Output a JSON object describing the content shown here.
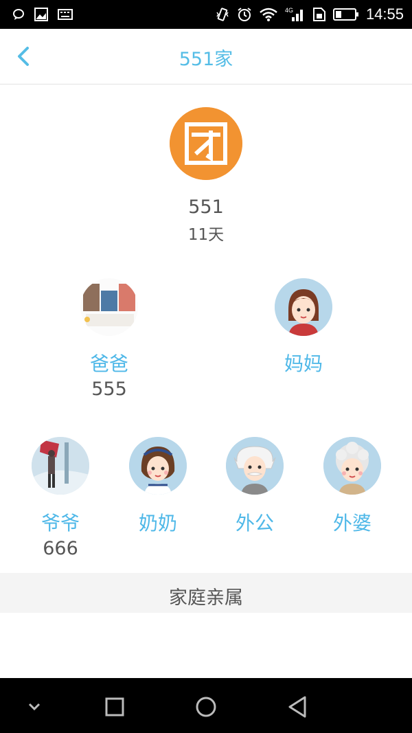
{
  "status_bar": {
    "time": "14:55",
    "network": "4G",
    "icons": [
      "chat-icon",
      "image-icon",
      "keyboard-icon",
      "vibrate-icon",
      "alarm-icon",
      "wifi-icon",
      "signal-icon",
      "sim-icon",
      "battery-icon"
    ]
  },
  "header": {
    "title": "551家",
    "back_icon": "chevron-left-icon"
  },
  "family_head": {
    "avatar_glyph": "团",
    "name": "551",
    "days": "11天"
  },
  "parents": [
    {
      "role": "爸爸",
      "name": "555"
    },
    {
      "role": "妈妈",
      "name": ""
    }
  ],
  "grandparents": [
    {
      "role": "爷爷",
      "name": "666"
    },
    {
      "role": "奶奶",
      "name": ""
    },
    {
      "role": "外公",
      "name": ""
    },
    {
      "role": "外婆",
      "name": ""
    }
  ],
  "section": {
    "title": "家庭亲属"
  },
  "nav": {
    "icons": [
      "chevron-down-icon",
      "recent-apps-icon",
      "home-icon",
      "back-icon"
    ]
  },
  "colors": {
    "accent": "#55bde6",
    "head_avatar": "#f29331",
    "avatar_bg": "#b7d7ea"
  }
}
